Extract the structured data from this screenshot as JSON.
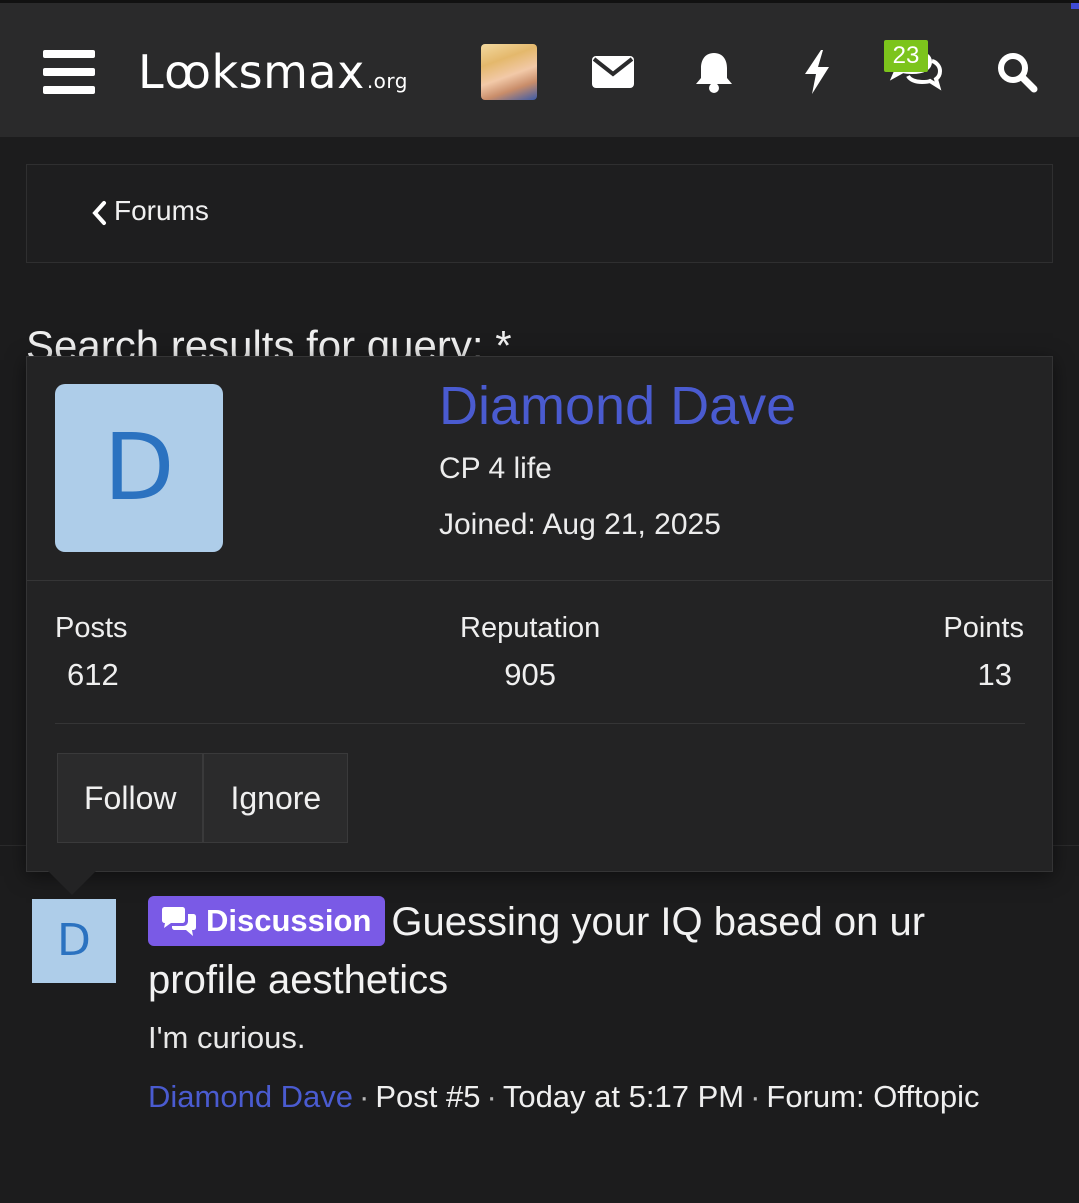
{
  "header": {
    "logo_main": "Lꝏksmax",
    "logo_tld": ".org",
    "icons": [
      "menu-icon",
      "avatar",
      "envelope-icon",
      "bell-icon",
      "lightning-icon",
      "conversations-icon",
      "search-icon"
    ],
    "conversations_badge": "23"
  },
  "breadcrumb": {
    "label": "Forums"
  },
  "search": {
    "heading": "Search results for query: *"
  },
  "member_card": {
    "initial": "D",
    "name": "Diamond Dave",
    "user_title": "CP 4 life",
    "joined": "Joined: Aug 21, 2025",
    "stats": {
      "posts_label": "Posts",
      "posts_value": "612",
      "reputation_label": "Reputation",
      "reputation_value": "905",
      "points_label": "Points",
      "points_value": "13"
    },
    "buttons": {
      "follow": "Follow",
      "ignore": "Ignore"
    },
    "colors": {
      "name": "#4a5bd0",
      "avatar_bg": "#aecde9",
      "avatar_fg": "#2b72c0"
    }
  },
  "result": {
    "initial": "D",
    "prefix": "Discussion",
    "title": "Guessing your IQ based on ur profile aesthetics",
    "snippet": "I'm curious.",
    "author": "Diamond Dave",
    "post": "Post #5",
    "time": "Today at 5:17 PM",
    "forum": "Forum: Offtopic",
    "separator": "·",
    "colors": {
      "prefix_bg": "#7a5ae6",
      "badge": "#7cc41c"
    }
  }
}
